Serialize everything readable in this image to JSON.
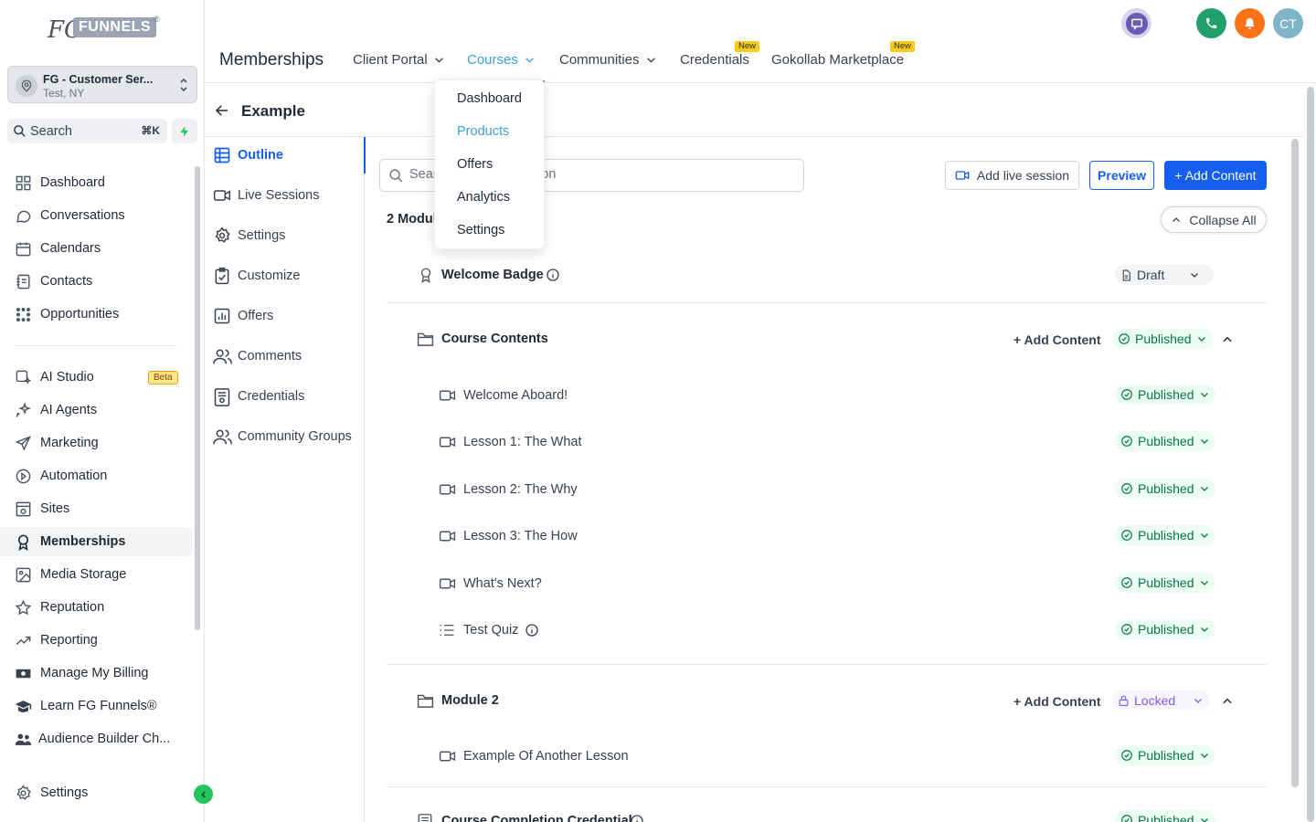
{
  "logo": {
    "fg": "FG",
    "funnels": "FUNNELS",
    "reg": "®"
  },
  "account": {
    "name": "FG - Customer Ser...",
    "location": "Test, NY"
  },
  "search": {
    "label": "Search",
    "shortcut": "⌘K"
  },
  "sidebar": {
    "items": [
      {
        "label": "Dashboard",
        "icon": "dashboard-icon"
      },
      {
        "label": "Conversations",
        "icon": "chat-icon"
      },
      {
        "label": "Calendars",
        "icon": "calendar-icon"
      },
      {
        "label": "Contacts",
        "icon": "contacts-icon"
      },
      {
        "label": "Opportunities",
        "icon": "opportunities-icon"
      },
      {
        "label": "AI Studio",
        "icon": "ai-studio-icon",
        "badge": "Beta"
      },
      {
        "label": "AI Agents",
        "icon": "sparkle-icon"
      },
      {
        "label": "Marketing",
        "icon": "send-icon"
      },
      {
        "label": "Automation",
        "icon": "automation-icon"
      },
      {
        "label": "Sites",
        "icon": "sites-icon"
      },
      {
        "label": "Memberships",
        "icon": "badge-icon",
        "active": true
      },
      {
        "label": "Media Storage",
        "icon": "image-icon"
      },
      {
        "label": "Reputation",
        "icon": "star-icon"
      },
      {
        "label": "Reporting",
        "icon": "trend-icon"
      },
      {
        "label": "Manage My Billing",
        "icon": "money-icon"
      },
      {
        "label": "Learn FG Funnels®",
        "icon": "graduation-icon"
      },
      {
        "label": "Audience Builder Ch...",
        "icon": "people-icon"
      }
    ],
    "settings_label": "Settings"
  },
  "header": {
    "title": "Memberships",
    "tabs": [
      {
        "label": "Client Portal",
        "dropdown": true
      },
      {
        "label": "Courses",
        "dropdown": true,
        "active": true
      },
      {
        "label": "Communities",
        "dropdown": true
      },
      {
        "label": "Credentials",
        "badge": "New"
      },
      {
        "label": "Gokollab Marketplace",
        "badge": "New"
      }
    ],
    "avatar_initials": "CT",
    "colors": {
      "phone": "#22a06b",
      "bell": "#f97316",
      "avatar": "#7fb3c8",
      "chat": "#6b5bb6"
    }
  },
  "courses_menu": {
    "items": [
      "Dashboard",
      "Products",
      "Offers",
      "Analytics",
      "Settings"
    ],
    "active": "Products"
  },
  "course": {
    "title": "Example",
    "subnav": [
      {
        "label": "Outline",
        "icon": "grid-icon",
        "active": true
      },
      {
        "label": "Live Sessions",
        "icon": "video-icon"
      },
      {
        "label": "Settings",
        "icon": "gear-icon"
      },
      {
        "label": "Customize",
        "icon": "clipboard-check-icon"
      },
      {
        "label": "Offers",
        "icon": "chart-bar-icon"
      },
      {
        "label": "Comments",
        "icon": "users-icon"
      },
      {
        "label": "Credentials",
        "icon": "certificate-icon"
      },
      {
        "label": "Community Groups",
        "icon": "users-icon"
      }
    ]
  },
  "outline": {
    "search_placeholder": "Search module or lesson",
    "add_live_label": "Add live session",
    "preview_label": "Preview",
    "add_content_label": "+ Add Content",
    "modules_count": "2 Modules",
    "collapse_all_label": "Collapse All",
    "inline_add_label": "+ Add Content",
    "welcome": {
      "title": "Welcome Badge",
      "status": "Draft"
    },
    "modules": [
      {
        "title": "Course Contents",
        "status": "Published",
        "lessons": [
          {
            "title": "Welcome Aboard!",
            "status": "Published",
            "icon": "video-icon"
          },
          {
            "title": "Lesson 1: The What",
            "status": "Published",
            "icon": "video-icon"
          },
          {
            "title": "Lesson 2: The Why",
            "status": "Published",
            "icon": "video-icon"
          },
          {
            "title": "Lesson 3: The How",
            "status": "Published",
            "icon": "video-icon"
          },
          {
            "title": "What's Next?",
            "status": "Published",
            "icon": "video-icon"
          },
          {
            "title": "Test Quiz",
            "status": "Published",
            "icon": "list-icon"
          }
        ]
      },
      {
        "title": "Module 2",
        "status": "Locked",
        "lessons": [
          {
            "title": "Example Of Another Lesson",
            "status": "Published",
            "icon": "video-icon"
          }
        ]
      }
    ],
    "credential": {
      "title": "Course Completion Credential",
      "status": "Published"
    }
  }
}
